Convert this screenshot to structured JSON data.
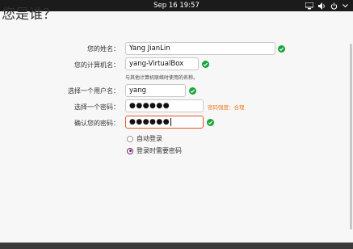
{
  "topbar": {
    "clock": "Sep 16  19:57"
  },
  "window": {
    "heading": "您是谁？",
    "fields": {
      "name_label": "您的姓名：",
      "name_value": "Yang JianLin",
      "computer_label": "您的计算机名：",
      "computer_value": "yang-VirtualBox",
      "computer_hint": "与其他计算机联络时使用的名称。",
      "username_label": "选择一个用户名：",
      "username_value": "yang",
      "password_label": "选择一个密码：",
      "password_value": "●●●●●●",
      "password_strength": "密码强度：合理",
      "confirm_label": "确认您的密码：",
      "confirm_value": "●●●●●●"
    },
    "login": {
      "auto_label": "自动登录",
      "require_label": "登录时需要密码",
      "selected": "require"
    }
  },
  "colors": {
    "check": "#18a53a",
    "accent": "#e95420",
    "strength": "#f37c22",
    "radio": "#77216f"
  },
  "icons": [
    "network-icon",
    "volume-icon",
    "power-icon",
    "check-icon"
  ]
}
